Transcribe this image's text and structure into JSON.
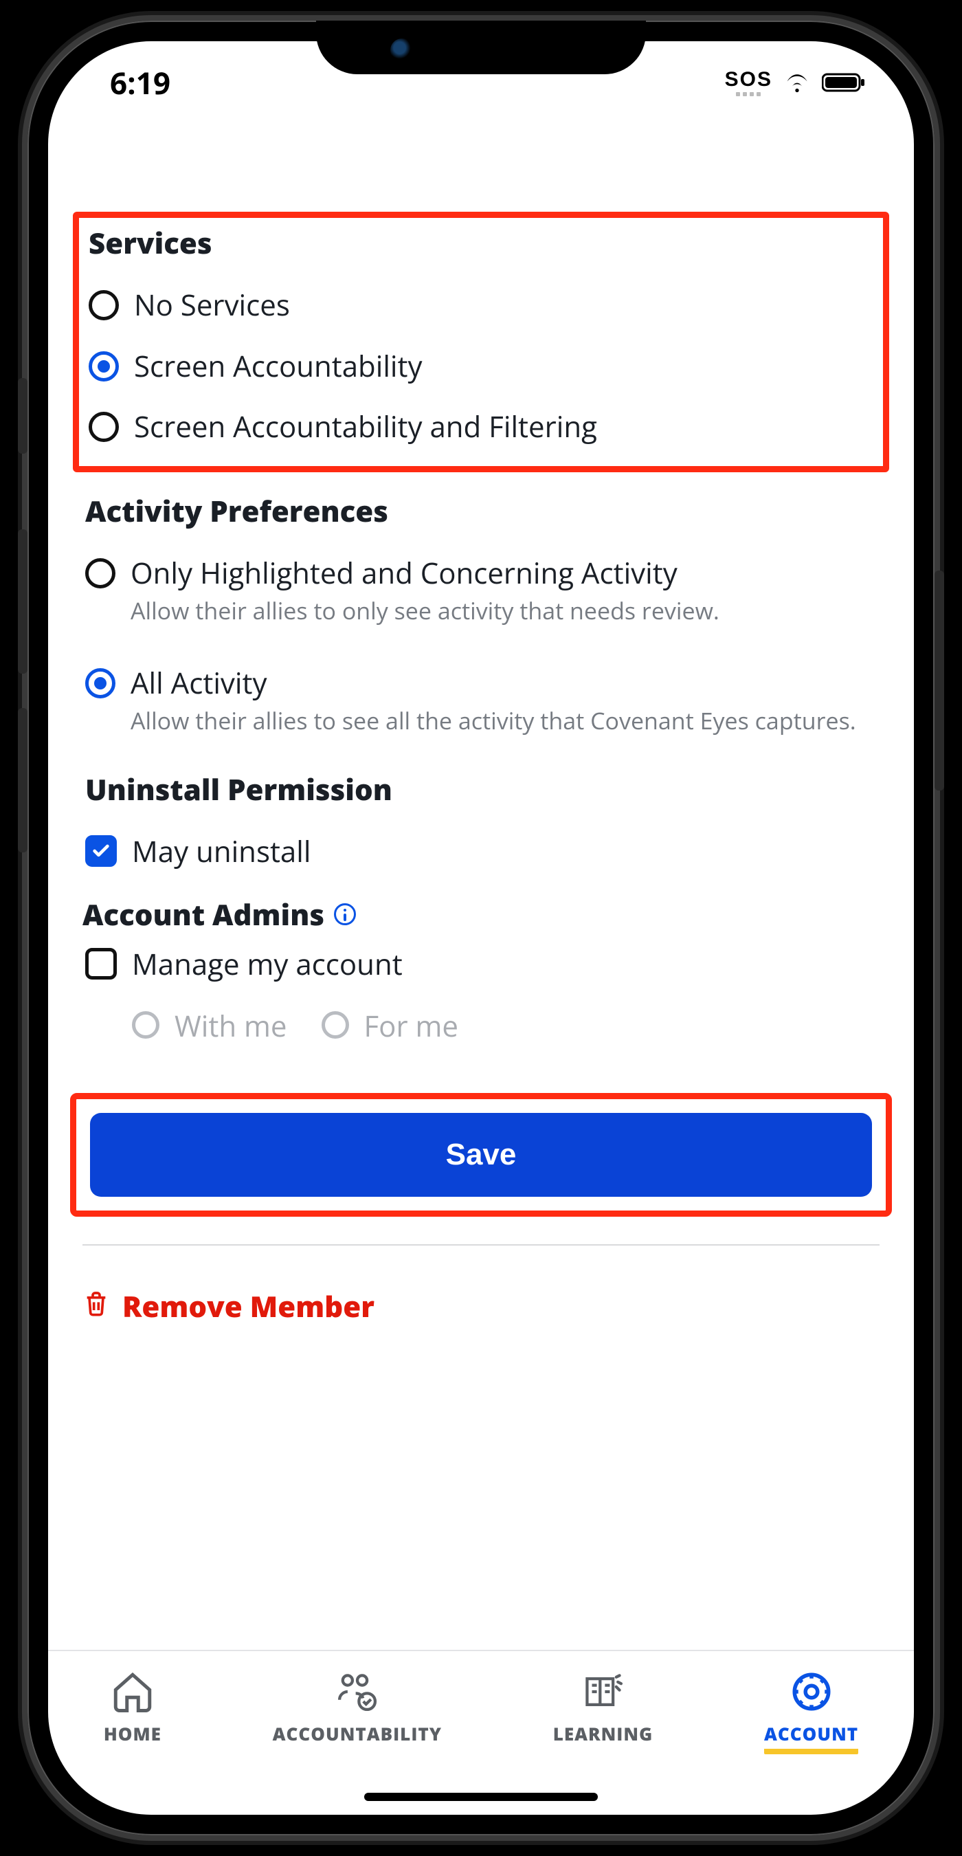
{
  "statusbar": {
    "time": "6:19",
    "sos": "SOS"
  },
  "services": {
    "title": "Services",
    "options": [
      {
        "label": "No Services",
        "selected": false
      },
      {
        "label": "Screen Accountability",
        "selected": true
      },
      {
        "label": "Screen Accountability and Filtering",
        "selected": false
      }
    ]
  },
  "activity": {
    "title": "Activity Preferences",
    "options": [
      {
        "label": "Only Highlighted and Concerning Activity",
        "desc": "Allow their allies to only see activity that needs review.",
        "selected": false
      },
      {
        "label": "All Activity",
        "desc": "Allow their allies to see all the activity that Covenant Eyes captures.",
        "selected": true
      }
    ]
  },
  "uninstall": {
    "title": "Uninstall Permission",
    "checkbox_label": "May uninstall",
    "checked": true
  },
  "admins": {
    "title": "Account Admins",
    "checkbox_label": "Manage my account",
    "checked": false,
    "sub_options": [
      {
        "label": "With me"
      },
      {
        "label": "For me"
      }
    ]
  },
  "save_label": "Save",
  "remove_label": "Remove Member",
  "tabs": [
    {
      "label": "HOME"
    },
    {
      "label": "ACCOUNTABILITY"
    },
    {
      "label": "LEARNING"
    },
    {
      "label": "ACCOUNT"
    }
  ],
  "accent": "#0a53e4",
  "danger": "#e11a0b",
  "highlight_border": "#ff2b12"
}
